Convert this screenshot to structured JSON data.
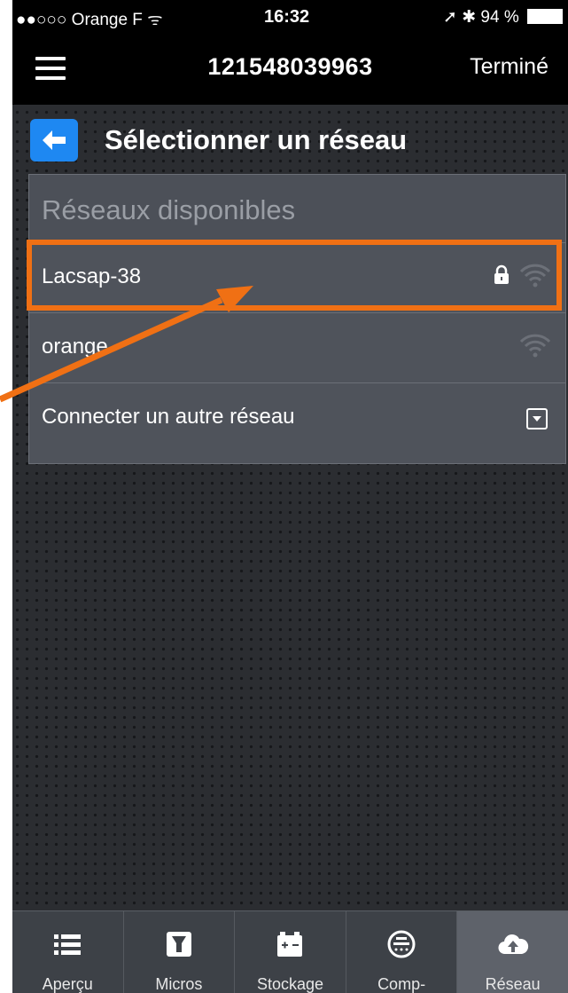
{
  "status_bar": {
    "carrier": "●●○○○ Orange F",
    "time": "16:32",
    "battery": "94 %"
  },
  "nav": {
    "title": "121548039963",
    "done_label": "Terminé"
  },
  "header": {
    "title": "Sélectionner un réseau"
  },
  "networks": {
    "section_label": "Réseaux disponibles",
    "items": [
      {
        "name": "Lacsap-38",
        "secured": true
      },
      {
        "name": "orange",
        "secured": false
      }
    ],
    "other_label": "Connecter un autre réseau"
  },
  "tabs": [
    {
      "label": "Aperçu",
      "icon": "list-icon"
    },
    {
      "label": "Micros",
      "icon": "micro-inverter-icon"
    },
    {
      "label": "Stockage",
      "icon": "battery-storage-icon"
    },
    {
      "label": "Comp-",
      "icon": "meter-icon"
    },
    {
      "label": "Réseau",
      "icon": "cloud-upload-icon",
      "active": true
    }
  ],
  "colors": {
    "accent": "#1e88f2",
    "highlight": "#f07014"
  }
}
